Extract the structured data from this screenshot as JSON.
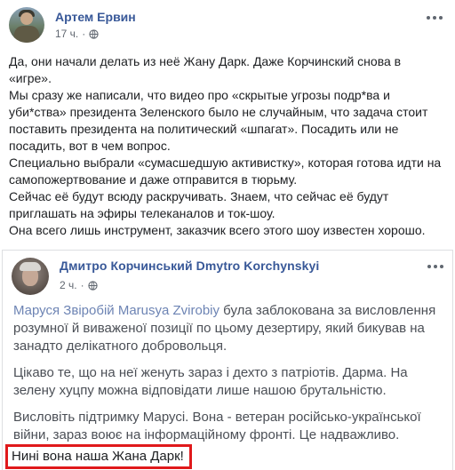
{
  "post": {
    "author": "Артем Ервин",
    "time": "17 ч.",
    "separator": "·",
    "icons": {
      "privacy": "globe-icon",
      "menu": "more-options-icon"
    },
    "paragraphs": [
      "Да, они начали делать из неё Жану Дарк. Даже Корчинский снова в «игре».",
      "Мы сразу же написали, что видео про «скрытые угрозы подр*ва и уби*ства» президента Зеленского было не случайным, что задача стоит поставить президента на политический «шпагат». Посадить или не посадить, вот в чем вопрос.",
      "Специально выбрали «сумасшедшую активистку», которая готова идти на самопожертвование и даже отправится в тюрьму.",
      "Сейчас её будут всюду раскручивать. Знаем, что сейчас её будут приглашать на эфиры телеканалов и ток-шоу.",
      "Она всего лишь инструмент, заказчик всего этого шоу известен хорошо."
    ]
  },
  "shared_post": {
    "author": "Дмитро Корчинський Dmytro Korchynskyi",
    "time": "2 ч.",
    "separator": "·",
    "icons": {
      "privacy": "globe-icon",
      "menu": "more-options-icon"
    },
    "mention": "Маруся Звіробій Marusya Zvirobiy",
    "p1_rest": " була заблокована за висловлення розумної й виваженої позиції по цьому дезертиру, який бикував на занадто делікатного добровольця.",
    "p2": "Цікаво те, що на неї женуть зараз і дехто з патріотів. Дарма. На зелену хуцпу можна відповідати лише нашою брутальністю.",
    "p3": "Висловіть підтримку Марусі. Вона - ветеран російсько-української війни, зараз воює на інформаційному фронті. Це надважливо.",
    "highlighted_line": "Нині вона наша Жана Дарк!",
    "highlight_color": "#e0191b"
  }
}
